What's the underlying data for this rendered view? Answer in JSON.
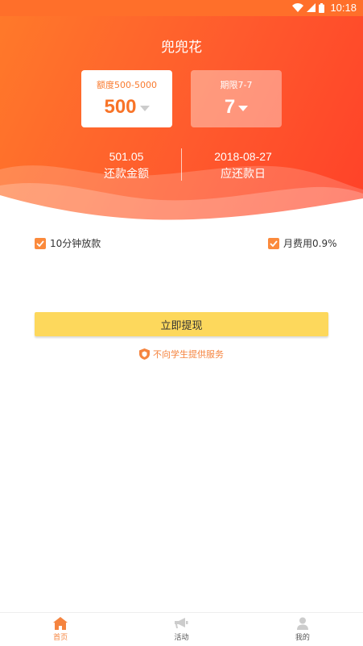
{
  "status_bar": {
    "time": "10:18"
  },
  "app": {
    "title": "兜兜花"
  },
  "amount_card": {
    "label": "额度500-5000",
    "value": "500"
  },
  "term_card": {
    "label": "期限7-7",
    "value": "7"
  },
  "summary": {
    "repay_amount": "501.05",
    "repay_amount_label": "还款金额",
    "due_date": "2018-08-27",
    "due_date_label": "应还款日"
  },
  "options": {
    "fast_loan": "10分钟放款",
    "monthly_fee": "月费用0.9%"
  },
  "actions": {
    "withdraw": "立即提现"
  },
  "notice": {
    "text": "不向学生提供服务"
  },
  "tabbar": {
    "items": [
      {
        "label": "首页",
        "icon": "home-icon",
        "active": true
      },
      {
        "label": "活动",
        "icon": "megaphone-icon",
        "active": false
      },
      {
        "label": "我的",
        "icon": "user-icon",
        "active": false
      }
    ]
  },
  "colors": {
    "primary_orange": "#ff5a2d",
    "accent_orange": "#f5843f",
    "button_yellow": "#fdd85c"
  }
}
